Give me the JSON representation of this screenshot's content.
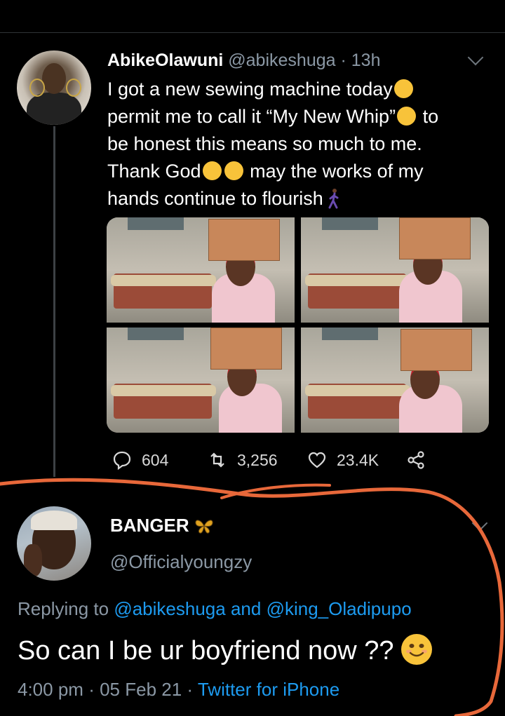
{
  "tweet": {
    "author_name": "AbikeOlawuni",
    "author_handle": "@abikeshuga",
    "separator": "·",
    "time_ago": "13h",
    "text_lines": [
      "I got a new sewing machine today",
      "permit me to call it “My New Whip”",
      " to",
      "be honest this means so much to me.",
      "Thank God",
      " may the works of my",
      "hands continue to flourish"
    ],
    "emojis": [
      "pleading-face-emoji",
      "tears-of-joy-emoji",
      "smiling-halo-emoji",
      "person-walking-emoji"
    ],
    "photos": [
      "sewing-machine-photo-1",
      "sewing-machine-photo-2",
      "sewing-machine-photo-3",
      "sewing-machine-photo-4"
    ],
    "actions": {
      "replies": "604",
      "retweets": "3,256",
      "likes": "23.4K"
    }
  },
  "reply": {
    "author_name": "BANGER",
    "author_handle": "@Officialyoungzy",
    "replying_prefix": "Replying to",
    "mention_1": "@abikeshuga",
    "and_word": "and",
    "mention_2": "@king_Oladipupo",
    "text": "So can I be ur boyfriend now ??",
    "time": "4:00 pm",
    "separator": "·",
    "date": "05 Feb 21",
    "separator_2": "·",
    "source": "Twitter for iPhone"
  },
  "colors": {
    "background": "#000000",
    "secondary_text": "#8b98a5",
    "link": "#1d9bf0",
    "annotation_stroke": "#e8683a"
  }
}
